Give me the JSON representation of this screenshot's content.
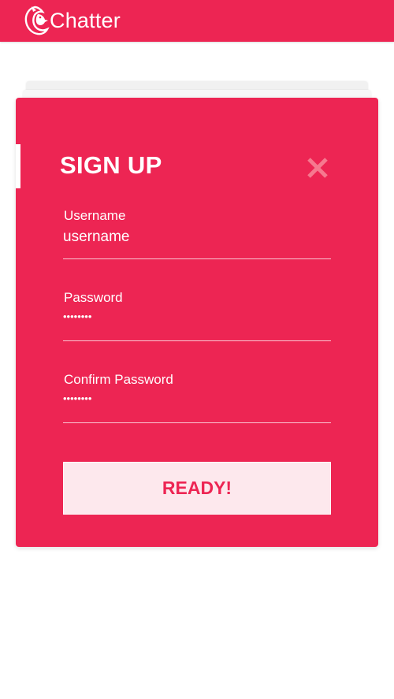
{
  "header": {
    "app_name": "Chatter",
    "logo_icon": "dolphin-logo-icon",
    "background_color": "#ed2553"
  },
  "signup": {
    "title": "SIGN UP",
    "close_icon": "close-icon",
    "fields": {
      "username": {
        "label": "Username",
        "value": "",
        "placeholder": "username"
      },
      "password": {
        "label": "Password",
        "value": "••••••••"
      },
      "confirm_password": {
        "label": "Confirm Password",
        "value": "••••••••"
      }
    },
    "submit_label": "READY!",
    "card_color": "#ed2553",
    "button_bg": "#fde8ed"
  }
}
